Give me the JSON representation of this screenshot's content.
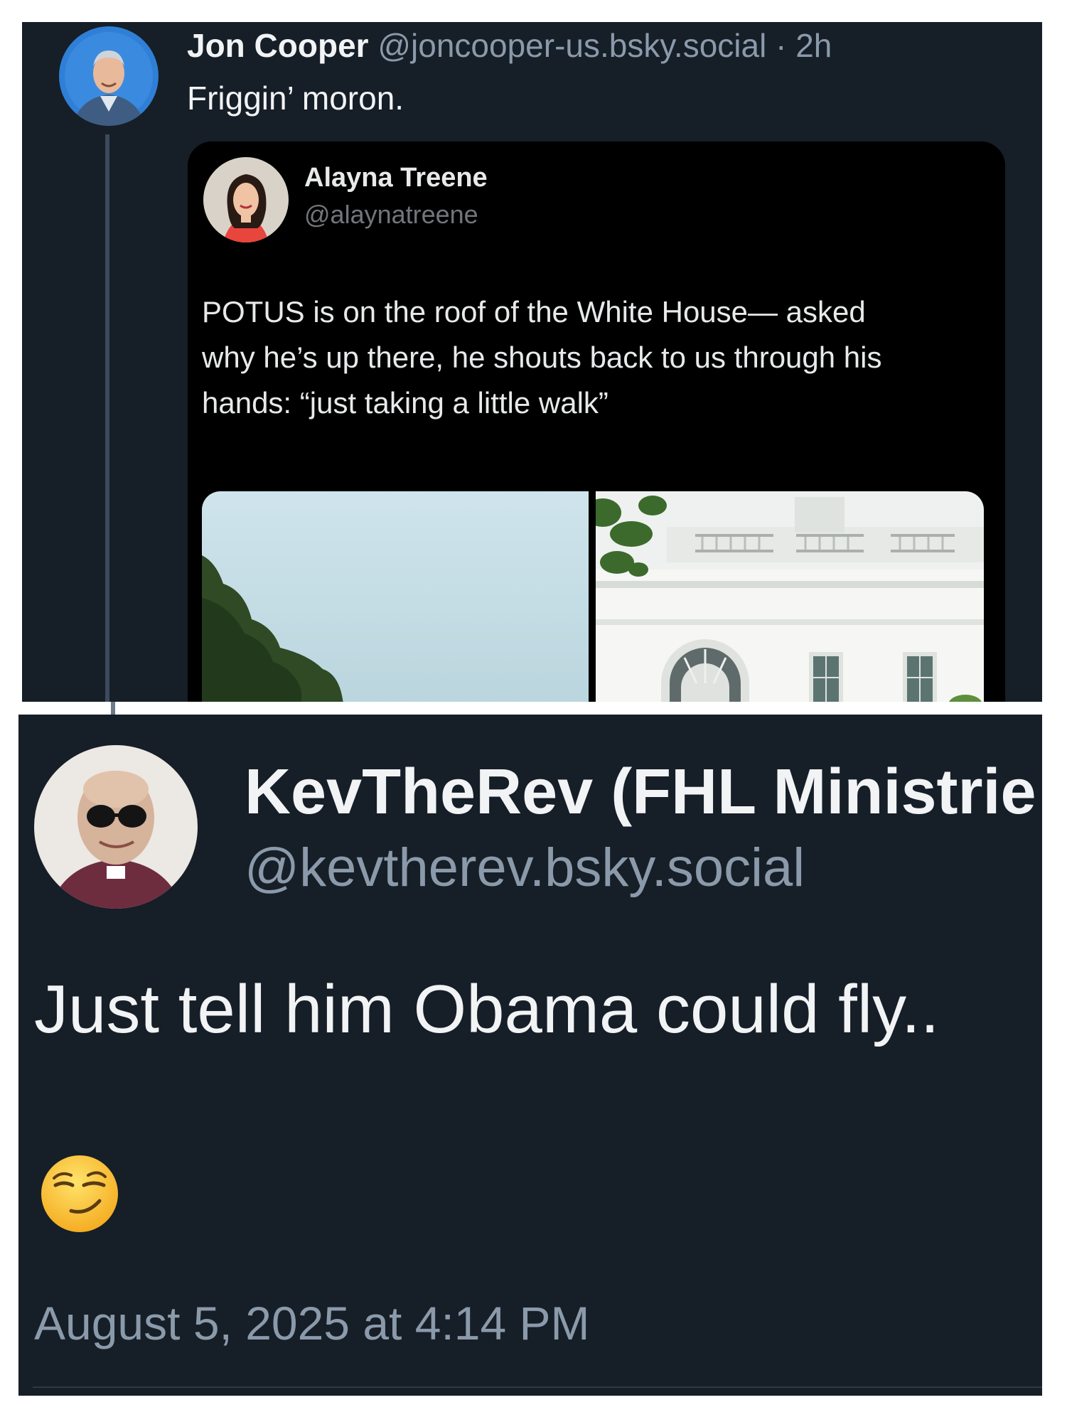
{
  "top_post": {
    "author_name": "Jon Cooper",
    "author_handle": "@joncooper-us.bsky.social",
    "separator": "·",
    "time_ago": "2h",
    "text": "Friggin’ moron.",
    "quoted": {
      "author_name": "Alayna Treene",
      "author_handle": "@alaynatreene",
      "text_lines": [
        "POTUS is on the roof of the White House— asked",
        "why he’s up there, he shouts back to us through his",
        "hands: “just taking a little walk”"
      ]
    }
  },
  "bottom_post": {
    "author_name": "KevTheRev (FHL Ministrie",
    "author_handle": "@kevtherev.bsky.social",
    "text": "Just tell him Obama could fly..",
    "emoji": "smirking-face",
    "timestamp": "August 5, 2025 at 4:14 PM"
  },
  "colors": {
    "background": "#161e27",
    "quote_background": "#000000",
    "text": "#f1f3f5",
    "muted": "#8b9aaa"
  }
}
